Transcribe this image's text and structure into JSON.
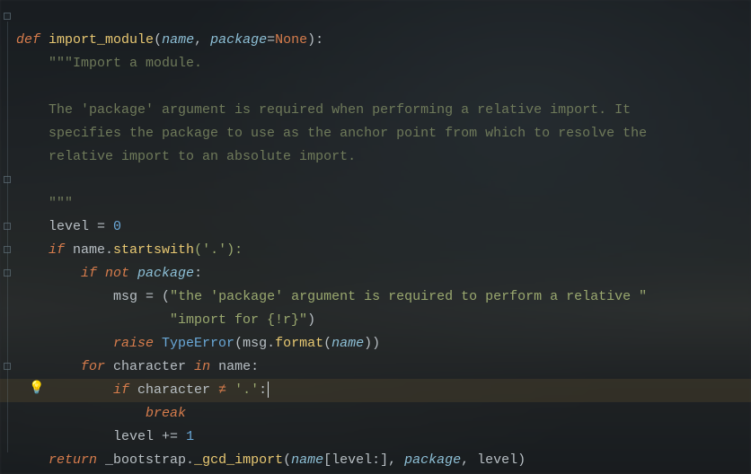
{
  "code": {
    "l1": {
      "def": "def",
      "fname": "import_module",
      "p_open": "(",
      "p1": "name",
      "c1": ", ",
      "p2": "package",
      "eq": "=",
      "defv": "None",
      "p_close": "):"
    },
    "l2": {
      "doc": "\"\"\"Import a module."
    },
    "l4": {
      "doc": "The 'package' argument is required when performing a relative import. It"
    },
    "l5": {
      "doc": "specifies the package to use as the anchor point from which to resolve the"
    },
    "l6": {
      "doc": "relative import to an absolute import."
    },
    "l8": {
      "doc": "\"\"\""
    },
    "l9": {
      "var": "level",
      "op": " = ",
      "num": "0"
    },
    "l10": {
      "kw": "if",
      "var": " name.",
      "method": "startswith",
      "args": "('.'):"
    },
    "l11": {
      "kw1": "if",
      "kw2": " not ",
      "var": "package",
      "colon": ":"
    },
    "l12": {
      "var": "msg",
      "op": " = (",
      "str": "\"the 'package' argument is required to perform a relative \""
    },
    "l13": {
      "str": "\"import for {!r}\"",
      "close": ")"
    },
    "l14": {
      "kw": "raise",
      "type": " TypeError",
      "open": "(",
      "var": "msg.",
      "method": "format",
      "args_open": "(",
      "arg": "name",
      "close": "))"
    },
    "l15": {
      "kw1": "for",
      "var1": " character ",
      "kw2": "in",
      "var2": " name",
      "colon": ":"
    },
    "l16": {
      "kw": "if",
      "var": " character ",
      "neq": "≠",
      "str": " '.'",
      "colon": ":"
    },
    "l17": {
      "kw": "break"
    },
    "l18": {
      "var": "level",
      "op": " += ",
      "num": "1"
    },
    "l19": {
      "kw": "return",
      "var": " _bootstrap.",
      "method": "_gcd_import",
      "open": "(",
      "a1": "name",
      "sl": "[level:], ",
      "a2": "package",
      "rest": ", level)"
    }
  },
  "indent": {
    "i1": "    ",
    "i2": "        ",
    "i3": "            ",
    "i4": "                ",
    "i4b": "                   "
  }
}
